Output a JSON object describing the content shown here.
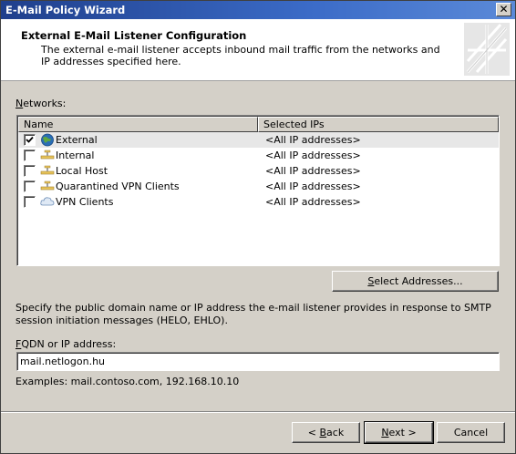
{
  "window": {
    "title": "E-Mail Policy Wizard",
    "close_glyph": "✕"
  },
  "header": {
    "title": "External E-Mail Listener Configuration",
    "description": "The external e-mail listener accepts inbound mail traffic from the networks and IP addresses specified here."
  },
  "networks": {
    "label_accel": "N",
    "label_rest": "etworks:",
    "columns": [
      "Name",
      "Selected IPs"
    ],
    "rows": [
      {
        "name": "External",
        "ips": "<All IP addresses>",
        "checked": true,
        "icon": "globe-icon"
      },
      {
        "name": "Internal",
        "ips": "<All IP addresses>",
        "checked": false,
        "icon": "network-icon"
      },
      {
        "name": "Local Host",
        "ips": "<All IP addresses>",
        "checked": false,
        "icon": "network-icon"
      },
      {
        "name": "Quarantined VPN Clients",
        "ips": "<All IP addresses>",
        "checked": false,
        "icon": "network-icon"
      },
      {
        "name": "VPN Clients",
        "ips": "<All IP addresses>",
        "checked": false,
        "icon": "cloud-icon"
      }
    ]
  },
  "select_addresses": {
    "accel": "S",
    "rest": "elect Addresses..."
  },
  "smtp_description": "Specify the public domain name or IP address the e-mail listener provides in response to SMTP session initiation messages (HELO, EHLO).",
  "fqdn": {
    "label_accel": "F",
    "label_rest": "QDN or IP address:",
    "value": "mail.netlogon.hu",
    "examples": "Examples: mail.contoso.com, 192.168.10.10"
  },
  "footer": {
    "back_prefix": "< ",
    "back_accel": "B",
    "back_rest": "ack",
    "next_accel": "N",
    "next_rest": "ext >",
    "cancel": "Cancel"
  }
}
